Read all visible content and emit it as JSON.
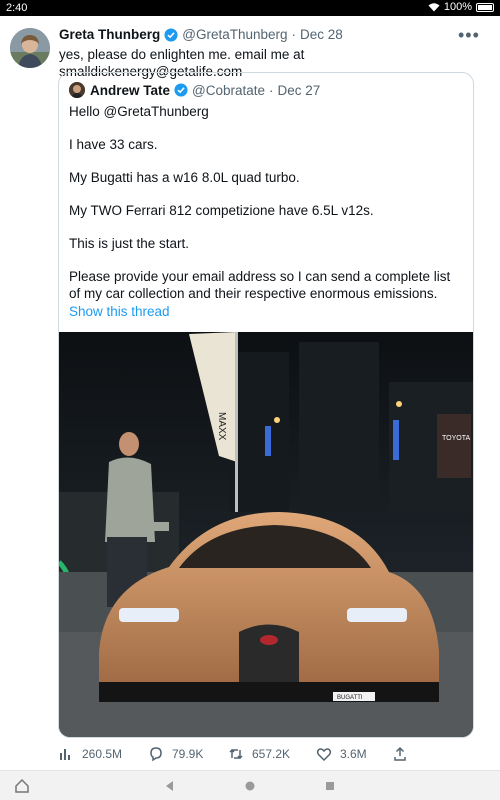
{
  "status_bar": {
    "time": "2:40",
    "battery": "100%",
    "wifi_icon": "wifi-icon",
    "battery_icon": "battery-icon"
  },
  "tweet": {
    "author_name": "Greta Thunberg",
    "handle": "@GretaThunberg",
    "separator": "·",
    "date": "Dec 28",
    "text": "yes, please do enlighten me. email me at smalldickenergy@getalife.com",
    "more_icon": "more-icon",
    "more_label": "•••"
  },
  "quoted_tweet": {
    "author_name": "Andrew Tate",
    "handle": "@Cobratate",
    "separator": "·",
    "date": "Dec 27",
    "lines": [
      "Hello @GretaThunberg",
      "I have 33 cars.",
      "My Bugatti has a w16 8.0L quad turbo.",
      "My TWO Ferrari 812 competizione have 6.5L v12s.",
      "This is just the start.",
      "Please provide your email address so I can send a complete list of my car collection and their respective enormous emissions."
    ],
    "show_thread": "Show this thread"
  },
  "photo": {
    "banner_text": "MAXX",
    "sign_text": "TOYOTA",
    "plate_text": "BUGATTI",
    "colors": {
      "car_body": "#c8895a",
      "sky": "#101418",
      "ground": "#4a4f52"
    }
  },
  "actions": {
    "views": "260.5M",
    "replies": "79.9K",
    "retweets": "657.2K",
    "likes": "3.6M"
  },
  "colors": {
    "accent": "#1d9bf0",
    "muted": "#536471",
    "border": "#cfd9de"
  }
}
